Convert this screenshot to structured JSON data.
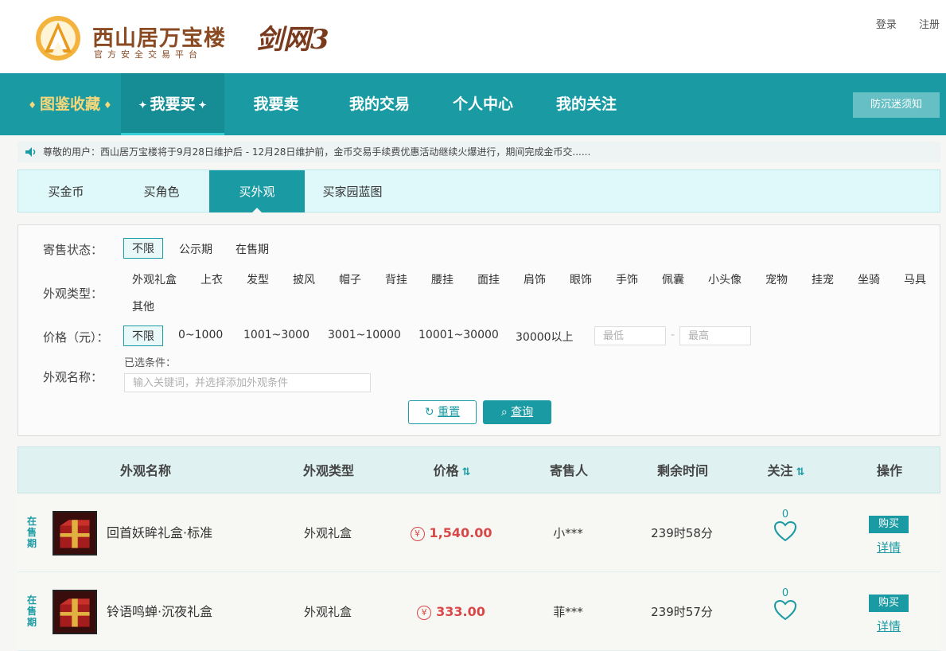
{
  "header": {
    "logo_title": "西山居万宝楼",
    "logo_subtitle": "官方安全交易平台",
    "game_logo": "剑网3",
    "login": "登录",
    "register": "注册"
  },
  "nav": {
    "items": [
      "图鉴收藏",
      "我要买",
      "我要卖",
      "我的交易",
      "个人中心",
      "我的关注"
    ],
    "notice_button": "防沉迷须知"
  },
  "notice": {
    "text": "尊敬的用户：西山居万宝楼将于9月28日维护后 - 12月28日维护前，金币交易手续费优惠活动继续火爆进行，期间完成金币交......"
  },
  "subtabs": [
    "买金币",
    "买角色",
    "买外观",
    "买家园蓝图"
  ],
  "filter": {
    "status_label": "寄售状态：",
    "status_options": [
      "不限",
      "公示期",
      "在售期"
    ],
    "type_label": "外观类型：",
    "type_options": [
      "外观礼盒",
      "上衣",
      "发型",
      "披风",
      "帽子",
      "背挂",
      "腰挂",
      "面挂",
      "肩饰",
      "眼饰",
      "手饰",
      "佩囊",
      "小头像",
      "宠物",
      "挂宠",
      "坐骑",
      "马具",
      "其他"
    ],
    "price_label": "价格（元）：",
    "price_options": [
      "不限",
      "0~1000",
      "1001~3000",
      "3001~10000",
      "10001~30000",
      "30000以上"
    ],
    "price_min_placeholder": "最低",
    "price_sep": "-",
    "price_max_placeholder": "最高",
    "name_label": "外观名称：",
    "selected_label": "已选条件：",
    "name_placeholder": "输入关键词，并选择添加外观条件",
    "reset": "重置",
    "query": "查询"
  },
  "table": {
    "headers": [
      "外观名称",
      "外观类型",
      "价格",
      "寄售人",
      "剩余时间",
      "关注",
      "操作"
    ],
    "rows": [
      {
        "status": "在售期",
        "name": "回首妖眸礼盒·标准",
        "type": "外观礼盒",
        "price": "1,540.00",
        "seller": "小***",
        "time": "239时58分",
        "fav": "0",
        "buy": "购买",
        "detail": "详情"
      },
      {
        "status": "在售期",
        "name": "铃语鸣蝉·沉夜礼盒",
        "type": "外观礼盒",
        "price": "333.00",
        "seller": "菲***",
        "time": "239时57分",
        "fav": "0",
        "buy": "购买",
        "detail": "详情"
      }
    ]
  },
  "icons": {
    "yuan": "¥",
    "sort": "⇅",
    "reset_icon": "↻",
    "search_icon": "⌕"
  },
  "colors": {
    "primary": "#1a9ba3",
    "price": "#d94848",
    "brand": "#8a4a22"
  }
}
